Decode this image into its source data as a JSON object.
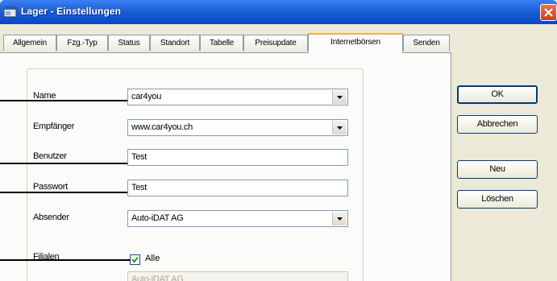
{
  "window": {
    "title": "Lager - Einstellungen"
  },
  "tabs": [
    {
      "label": "Allgemein"
    },
    {
      "label": "Fzg.-Typ"
    },
    {
      "label": "Status"
    },
    {
      "label": "Standort"
    },
    {
      "label": "Tabelle"
    },
    {
      "label": "Preisupdate"
    },
    {
      "label": "Internetbörsen"
    },
    {
      "label": "Senden"
    }
  ],
  "active_tab": "Internetbörsen",
  "form": {
    "name_label": "Name",
    "name_value": "car4you",
    "empfaenger_label": "Empfänger",
    "empfaenger_value": "www.car4you.ch",
    "benutzer_label": "Benutzer",
    "benutzer_value": "Test",
    "passwort_label": "Passwort",
    "passwort_value": "Test",
    "absender_label": "Absender",
    "absender_value": "Auto-iDAT AG",
    "filialen_label": "Filialen",
    "alle_label": "Alle",
    "alle_checked": true,
    "filiale_value": "Auto-iDAT AG"
  },
  "buttons": {
    "ok": "OK",
    "abbrechen": "Abbrechen",
    "neu": "Neu",
    "loeschen": "Löschen"
  },
  "icons": {
    "app": "app-window-icon",
    "close": "close-icon",
    "dropdown": "chevron-down-icon",
    "check": "checkmark-icon"
  },
  "colors": {
    "titlebar": "#0a48c4",
    "active_tab_accent": "#f3b33d",
    "close": "#c8421d"
  }
}
